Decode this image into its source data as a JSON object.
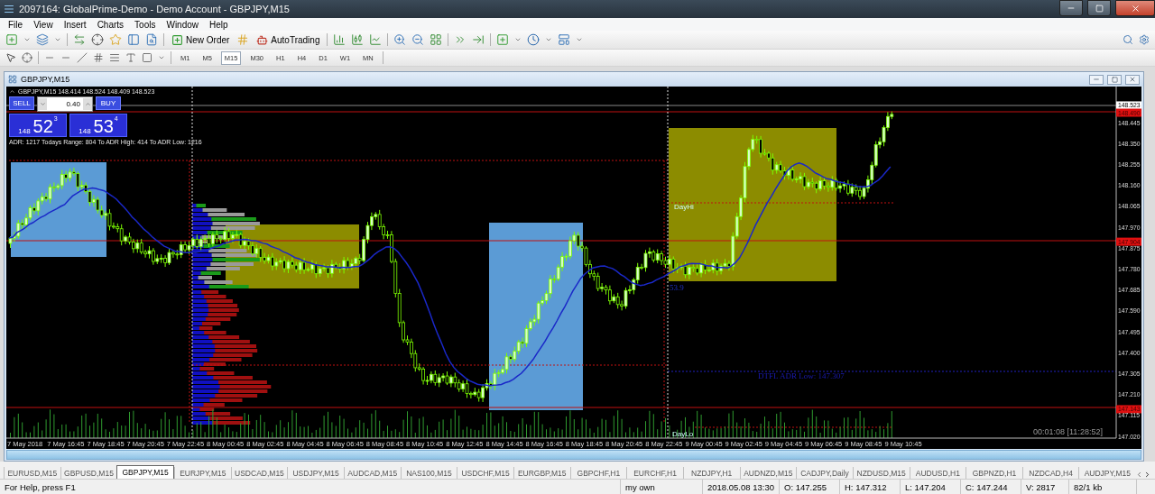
{
  "window": {
    "title": "2097164: GlobalPrime-Demo - Demo Account - GBPJPY,M15"
  },
  "menu": [
    "File",
    "View",
    "Insert",
    "Charts",
    "Tools",
    "Window",
    "Help"
  ],
  "toolbar": {
    "new_order": "New Order",
    "auto_trading": "AutoTrading"
  },
  "timeframes": [
    {
      "label": "M1",
      "selected": false
    },
    {
      "label": "M5",
      "selected": false
    },
    {
      "label": "M15",
      "selected": true
    },
    {
      "label": "M30",
      "selected": false
    },
    {
      "label": "H1",
      "selected": false
    },
    {
      "label": "H4",
      "selected": false
    },
    {
      "label": "D1",
      "selected": false
    },
    {
      "label": "W1",
      "selected": false
    },
    {
      "label": "MN",
      "selected": false
    }
  ],
  "chart_window": {
    "title": "GBPJPY,M15"
  },
  "chart": {
    "header": "GBPJPY,M15  148.414 148.524 148.409 148.523",
    "trade_panel": {
      "sell": "SELL",
      "buy": "BUY",
      "lots": "0.40",
      "sell_big": "148",
      "sell_pips": "52",
      "sell_frac": "3",
      "buy_big": "148",
      "buy_pips": "53",
      "buy_frac": "4"
    },
    "adr_info": "ADR: 1217  Todays Range: 804  To ADR High: 414  To ADR Low: 1216",
    "labels": [
      {
        "text": "DayHi",
        "kind": "session"
      },
      {
        "text": "53.9",
        "kind": "value"
      },
      {
        "text": "DTFL ADR Low: 147.307",
        "kind": "adr"
      },
      {
        "text": "DayLo",
        "kind": "session"
      }
    ],
    "price_labels": [
      {
        "text": "148.523",
        "kind": "bid"
      },
      {
        "text": "148.490",
        "kind": "level"
      },
      {
        "text": "148.445",
        "kind": "tick"
      },
      {
        "text": "148.350",
        "kind": "tick"
      },
      {
        "text": "148.255",
        "kind": "tick"
      },
      {
        "text": "148.160",
        "kind": "tick"
      },
      {
        "text": "148.065",
        "kind": "tick"
      },
      {
        "text": "147.970",
        "kind": "tick"
      },
      {
        "text": "147.904",
        "kind": "level"
      },
      {
        "text": "147.875",
        "kind": "tick"
      },
      {
        "text": "147.780",
        "kind": "tick"
      },
      {
        "text": "147.685",
        "kind": "tick"
      },
      {
        "text": "147.590",
        "kind": "tick"
      },
      {
        "text": "147.495",
        "kind": "tick"
      },
      {
        "text": "147.400",
        "kind": "tick"
      },
      {
        "text": "147.305",
        "kind": "tick"
      },
      {
        "text": "147.210",
        "kind": "tick"
      },
      {
        "text": "147.143",
        "kind": "level"
      },
      {
        "text": "147.115",
        "kind": "tick"
      },
      {
        "text": "147.020",
        "kind": "tick"
      }
    ],
    "time_labels": [
      "7 May 2018",
      "7 May 16:45",
      "7 May 18:45",
      "7 May 20:45",
      "7 May 22:45",
      "8 May 00:45",
      "8 May 02:45",
      "8 May 04:45",
      "8 May 06:45",
      "8 May 08:45",
      "8 May 10:45",
      "8 May 12:45",
      "8 May 14:45",
      "8 May 16:45",
      "8 May 18:45",
      "8 May 20:45",
      "8 May 22:45",
      "9 May 00:45",
      "9 May 02:45",
      "9 May 04:45",
      "9 May 06:45",
      "9 May 08:45",
      "9 May 10:45"
    ],
    "timer": "00:01:08 [11:28:52]"
  },
  "tabs": [
    {
      "label": "EURUSD,M15",
      "selected": false
    },
    {
      "label": "GBPUSD,M15",
      "selected": false
    },
    {
      "label": "GBPJPY,M15",
      "selected": true
    },
    {
      "label": "EURJPY,M15",
      "selected": false
    },
    {
      "label": "USDCAD,M15",
      "selected": false
    },
    {
      "label": "USDJPY,M15",
      "selected": false
    },
    {
      "label": "AUDCAD,M15",
      "selected": false
    },
    {
      "label": "NAS100,M15",
      "selected": false
    },
    {
      "label": "USDCHF,M15",
      "selected": false
    },
    {
      "label": "EURGBP,M15",
      "selected": false
    },
    {
      "label": "GBPCHF,H1",
      "selected": false
    },
    {
      "label": "EURCHF,H1",
      "selected": false
    },
    {
      "label": "NZDJPY,H1",
      "selected": false
    },
    {
      "label": "AUDNZD,M15",
      "selected": false
    },
    {
      "label": "CADJPY,Daily",
      "selected": false
    },
    {
      "label": "NZDUSD,M15",
      "selected": false
    },
    {
      "label": "AUDUSD,H1",
      "selected": false
    },
    {
      "label": "GBPNZD,H1",
      "selected": false
    },
    {
      "label": "NZDCAD,H4",
      "selected": false
    },
    {
      "label": "AUDJPY,M15",
      "selected": false
    }
  ],
  "status_bar": {
    "help": "For Help, press F1",
    "profile": "my own",
    "datetime": "2018.05.08 13:30",
    "open": "O: 147.255",
    "high": "H: 147.312",
    "low": "L: 147.204",
    "close": "C: 147.244",
    "volume": "V: 2817",
    "traffic": "82/1 kb"
  }
}
